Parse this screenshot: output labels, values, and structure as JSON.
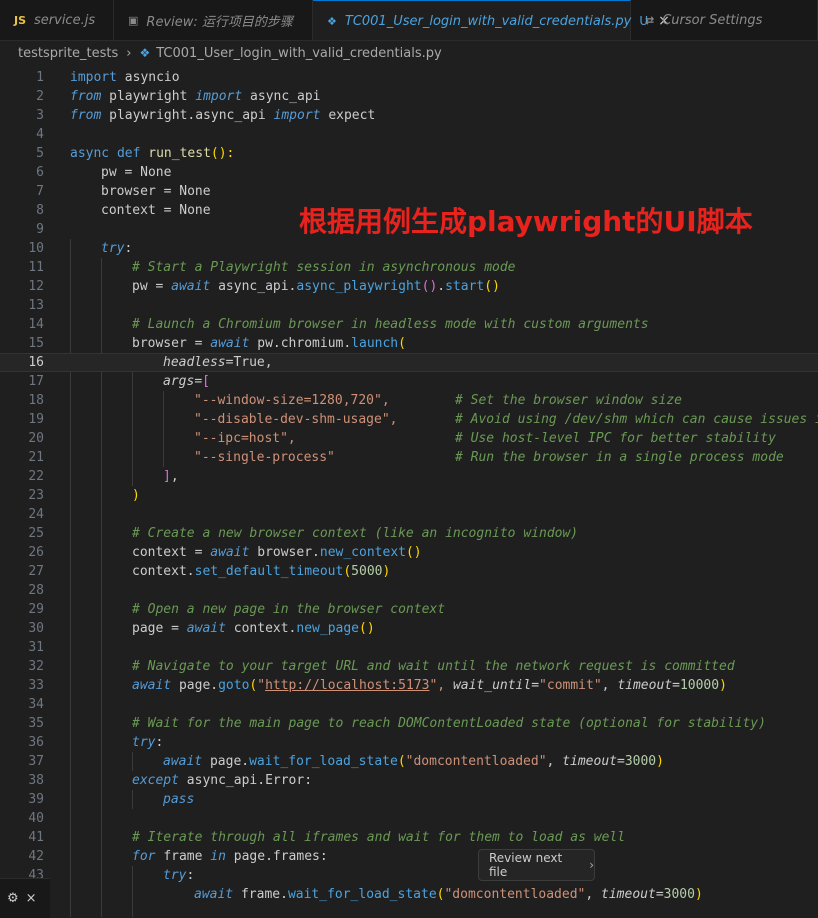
{
  "tabs": [
    {
      "label": "service.js",
      "icon": "JS"
    },
    {
      "label": "Review: 运行项目的步骤",
      "icon": "preview"
    },
    {
      "label": "TC001_User_login_with_valid_credentials.py",
      "icon": "python",
      "modified": "U",
      "close": "×"
    },
    {
      "label": "Cursor Settings",
      "icon": "gear"
    }
  ],
  "breadcrumb": {
    "folder": "testsprite_tests",
    "separator": "›",
    "file": "TC001_User_login_with_valid_credentials.py"
  },
  "overlay_title": "根据用例生成playwright的UI脚本",
  "review_button": {
    "label": "Review next file",
    "chevron": "›"
  },
  "bottom_left": {
    "icon": "⚙",
    "close": "×"
  },
  "line_numbers": [
    "1",
    "2",
    "3",
    "4",
    "5",
    "6",
    "7",
    "8",
    "9",
    "10",
    "11",
    "12",
    "13",
    "14",
    "15",
    "16",
    "17",
    "18",
    "19",
    "20",
    "21",
    "22",
    "23",
    "24",
    "25",
    "26",
    "27",
    "28",
    "29",
    "30",
    "31",
    "32",
    "33",
    "34",
    "35",
    "36",
    "37",
    "38",
    "39",
    "40",
    "41",
    "42",
    "43"
  ],
  "code": {
    "l1": [
      "import",
      "asyncio"
    ],
    "l2": [
      "from",
      "playwright",
      "import",
      "async_api"
    ],
    "l3": [
      "from",
      "playwright.async_api",
      "import",
      "expect"
    ],
    "l5": [
      "async",
      "def",
      "run_test",
      "():"
    ],
    "l6": [
      "pw",
      "=",
      "None"
    ],
    "l7": [
      "browser",
      "=",
      "None"
    ],
    "l8": [
      "context",
      "=",
      "None"
    ],
    "l10": [
      "try",
      ":"
    ],
    "l11": "# Start a Playwright session in asynchronous mode",
    "l12": [
      "pw",
      "=",
      "await",
      "async_api.",
      "async_playwright",
      "()",
      ".",
      "start",
      "()"
    ],
    "l14": "# Launch a Chromium browser in headless mode with custom arguments",
    "l15": [
      "browser",
      "=",
      "await",
      "pw.chromium.",
      "launch",
      "("
    ],
    "l16": [
      "headless",
      "=True,"
    ],
    "l17": [
      "args",
      "=",
      "["
    ],
    "l18": [
      "\"--window-size=1280,720\",",
      "# Set the browser window size"
    ],
    "l19": [
      "\"--disable-dev-shm-usage\",",
      "# Avoid using /dev/shm which can cause issues in"
    ],
    "l20": [
      "\"--ipc=host\",",
      "# Use host-level IPC for better stability"
    ],
    "l21": [
      "\"--single-process\"",
      "# Run the browser in a single process mode"
    ],
    "l22": [
      "]",
      ","
    ],
    "l23": [
      ")"
    ],
    "l25": "# Create a new browser context (like an incognito window)",
    "l26": [
      "context",
      "=",
      "await",
      "browser.",
      "new_context",
      "()"
    ],
    "l27": [
      "context.",
      "set_default_timeout",
      "(",
      "5000",
      ")"
    ],
    "l29": "# Open a new page in the browser context",
    "l30": [
      "page",
      "=",
      "await",
      "context.",
      "new_page",
      "()"
    ],
    "l32": "# Navigate to your target URL and wait until the network request is committed",
    "l33": [
      "await",
      "page.",
      "goto",
      "(",
      "\"",
      "http://localhost:5173",
      "\",",
      "wait_until",
      "=",
      "\"commit\"",
      ",",
      "timeout",
      "=",
      "10000",
      ")"
    ],
    "l35": "# Wait for the main page to reach DOMContentLoaded state (optional for stability)",
    "l36": [
      "try",
      ":"
    ],
    "l37": [
      "await",
      "page.",
      "wait_for_load_state",
      "(",
      "\"domcontentloaded\"",
      ",",
      "timeout",
      "=",
      "3000",
      ")"
    ],
    "l38": [
      "except",
      "async_api.Error:"
    ],
    "l39": [
      "pass"
    ],
    "l41": "# Iterate through all iframes and wait for them to load as well",
    "l42": [
      "for",
      "frame",
      "in",
      "page.frames:"
    ],
    "l43": [
      "try",
      ":"
    ],
    "l44": [
      "await",
      "frame.",
      "wait_for_load_state",
      "(",
      "\"domcontentloaded\"",
      ",",
      "timeout",
      "=",
      "3000",
      ")"
    ]
  }
}
